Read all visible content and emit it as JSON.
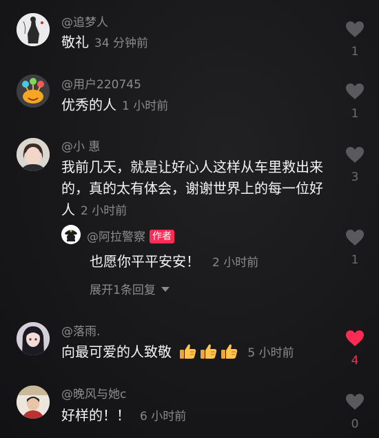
{
  "colors": {
    "background": "#161618",
    "username": "#8c8c8f",
    "text": "#f4f4f4",
    "heart_inactive": "#5a5a5e",
    "heart_active": "#fe2c55",
    "badge": "#fe2c55"
  },
  "comments": [
    {
      "username": "@追梦人",
      "text": "敬礼",
      "time": "34 分钟前",
      "likes": "1",
      "liked": false
    },
    {
      "username": "@用户220745",
      "text": "优秀的人",
      "time": "1 小时前",
      "likes": "1",
      "liked": false
    },
    {
      "username": "@小 惠",
      "text": "我前几天，就是让好心人这样从车里救出来的，真的太有体会，谢谢世界上的每一位好人",
      "time": "2 小时前",
      "likes": "3",
      "liked": false,
      "reply": {
        "username": "@阿拉警察",
        "badge": "作者",
        "text": "也愿你平平安安！",
        "time": "2 小时前",
        "likes": "1",
        "liked": false
      },
      "expand_label": "展开1条回复"
    },
    {
      "username": "@落雨.",
      "text": "向最可爱的人致敬",
      "emoji": [
        "thumbs-up-icon",
        "thumbs-up-icon",
        "thumbs-up-icon"
      ],
      "time": "5 小时前",
      "likes": "4",
      "liked": true
    },
    {
      "username": "@晚风与她c",
      "text": "好样的！！",
      "time": "6 小时前",
      "likes": "0",
      "liked": false
    }
  ]
}
